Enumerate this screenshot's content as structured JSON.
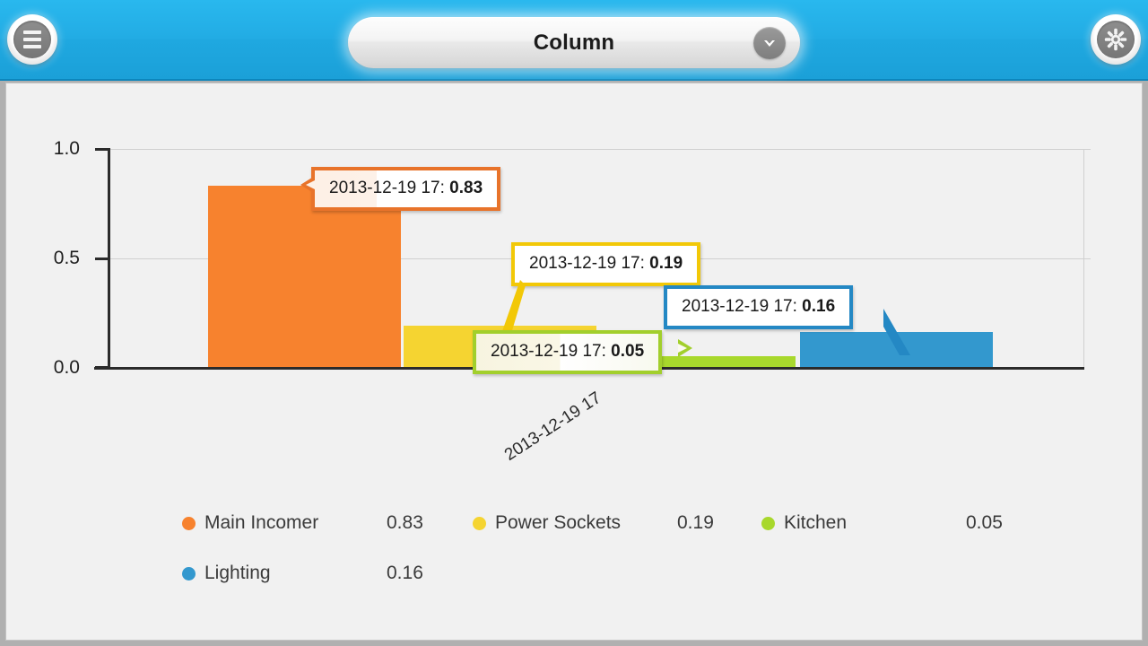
{
  "header": {
    "menu_icon": "hamburger-menu-icon",
    "settings_icon": "gear-icon",
    "title": "Column",
    "dropdown_icon": "chevron-down-icon"
  },
  "chart_data": {
    "type": "bar",
    "title": "",
    "xlabel": "",
    "ylabel": "",
    "categories": [
      "2013-12-19 17"
    ],
    "xtick_labels": [
      "2013-12-19 17"
    ],
    "ytick_labels": [
      "1.0",
      "0.5",
      "0.0"
    ],
    "ylim": [
      0.0,
      1.0
    ],
    "yticks": [
      0.0,
      0.5,
      1.0
    ],
    "grid": true,
    "legend_position": "bottom",
    "series": [
      {
        "name": "Main Incomer",
        "values": [
          0.83
        ],
        "color": "#F7822E"
      },
      {
        "name": "Power Sockets",
        "values": [
          0.19
        ],
        "color": "#F5D431"
      },
      {
        "name": "Kitchen",
        "values": [
          0.05
        ],
        "color": "#A8D82C"
      },
      {
        "name": "Lighting",
        "values": [
          0.16
        ],
        "color": "#3398CE"
      }
    ],
    "annotations": [
      {
        "text_prefix": "2013-12-19 17: ",
        "value": "0.83",
        "series": "Main Incomer",
        "color": "#E8732A"
      },
      {
        "text_prefix": "2013-12-19 17: ",
        "value": "0.19",
        "series": "Power Sockets",
        "color": "#F2C807"
      },
      {
        "text_prefix": "2013-12-19 17: ",
        "value": "0.16",
        "series": "Lighting",
        "color": "#2488C4"
      },
      {
        "text_prefix": "2013-12-19 17: ",
        "value": "0.05",
        "series": "Kitchen",
        "color": "#A2CF2C"
      }
    ]
  },
  "legend": [
    {
      "name": "Main Incomer",
      "value": "0.83",
      "color": "#F7822E"
    },
    {
      "name": "Power Sockets",
      "value": "0.19",
      "color": "#F5D431"
    },
    {
      "name": "Kitchen",
      "value": "0.05",
      "color": "#A8D82C"
    },
    {
      "name": "Lighting",
      "value": "0.16",
      "color": "#3398CE"
    }
  ]
}
